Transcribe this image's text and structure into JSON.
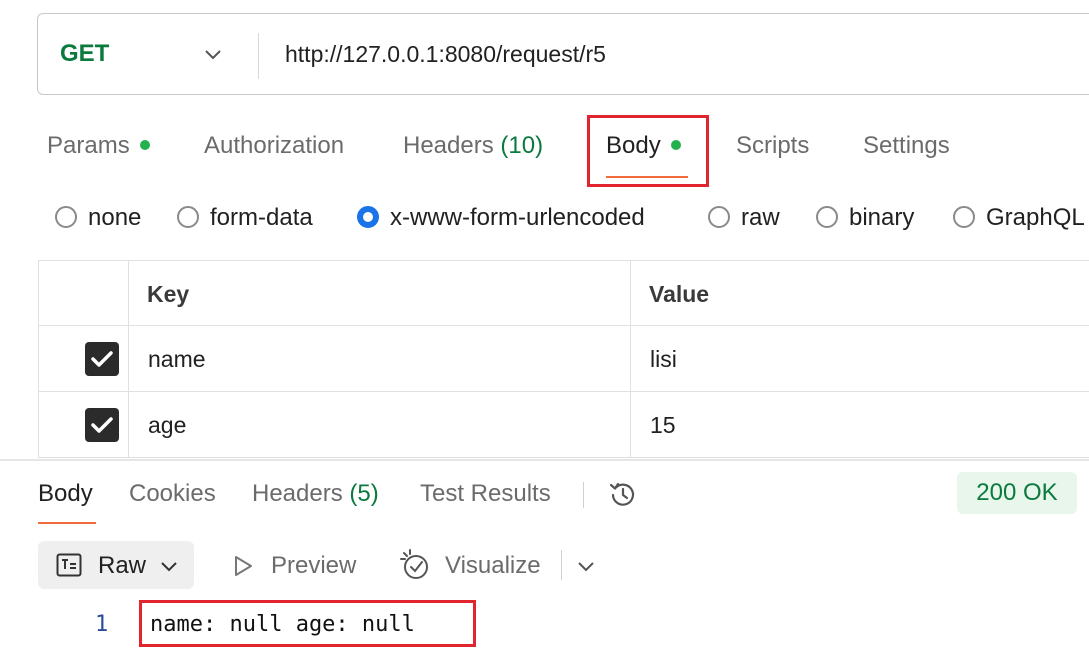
{
  "request": {
    "method": "GET",
    "url": "http://127.0.0.1:8080/request/r5"
  },
  "request_tabs": {
    "params": "Params",
    "authorization": "Authorization",
    "headers": "Headers",
    "headers_count": "(10)",
    "body": "Body",
    "scripts": "Scripts",
    "settings": "Settings"
  },
  "body_types": {
    "none": "none",
    "form_data": "form-data",
    "urlencoded": "x-www-form-urlencoded",
    "raw": "raw",
    "binary": "binary",
    "graphql": "GraphQL",
    "selected": "x-www-form-urlencoded"
  },
  "params_table": {
    "key_header": "Key",
    "value_header": "Value",
    "rows": [
      {
        "key": "name",
        "value": "lisi",
        "checked": true
      },
      {
        "key": "age",
        "value": "15",
        "checked": true
      }
    ]
  },
  "response_tabs": {
    "body": "Body",
    "cookies": "Cookies",
    "headers": "Headers",
    "headers_count": "(5)",
    "test_results": "Test Results"
  },
  "status": "200 OK",
  "toolbar": {
    "raw": "Raw",
    "preview": "Preview",
    "visualize": "Visualize"
  },
  "response_body": {
    "line_number": "1",
    "text": "name: null age: null"
  },
  "colors": {
    "accent": "#f26b3a",
    "method_green": "#0b7a3e",
    "highlight_red": "#e0252f",
    "radio_blue": "#1a73e8"
  }
}
